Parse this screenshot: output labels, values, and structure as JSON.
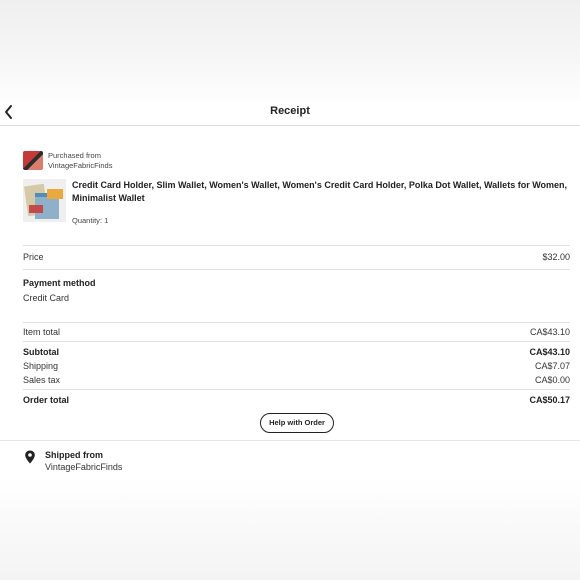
{
  "header": {
    "title": "Receipt",
    "back_icon": "chevron-left-icon"
  },
  "shop": {
    "purchased_from_label": "Purchased from",
    "name": "VintageFabricFinds"
  },
  "item": {
    "title": "Credit Card Holder, Slim Wallet, Women's Wallet, Women's Credit Card Holder, Polka Dot Wallet, Wallets for Women, Minimalist Wallet",
    "quantity": "Quantity: 1"
  },
  "price": {
    "label": "Price",
    "value": "$32.00"
  },
  "payment": {
    "label": "Payment method",
    "value": "Credit Card"
  },
  "totals": {
    "item_total": {
      "label": "Item total",
      "value": "CA$43.10"
    },
    "subtotal": {
      "label": "Subtotal",
      "value": "CA$43.10"
    },
    "shipping": {
      "label": "Shipping",
      "value": "CA$7.07"
    },
    "sales_tax": {
      "label": "Sales tax",
      "value": "CA$0.00"
    },
    "order_total": {
      "label": "Order total",
      "value": "CA$50.17"
    }
  },
  "help_button": {
    "label": "Help with Order"
  },
  "shipped_from": {
    "label": "Shipped from",
    "shop": "VintageFabricFinds",
    "icon": "location-pin-icon"
  }
}
